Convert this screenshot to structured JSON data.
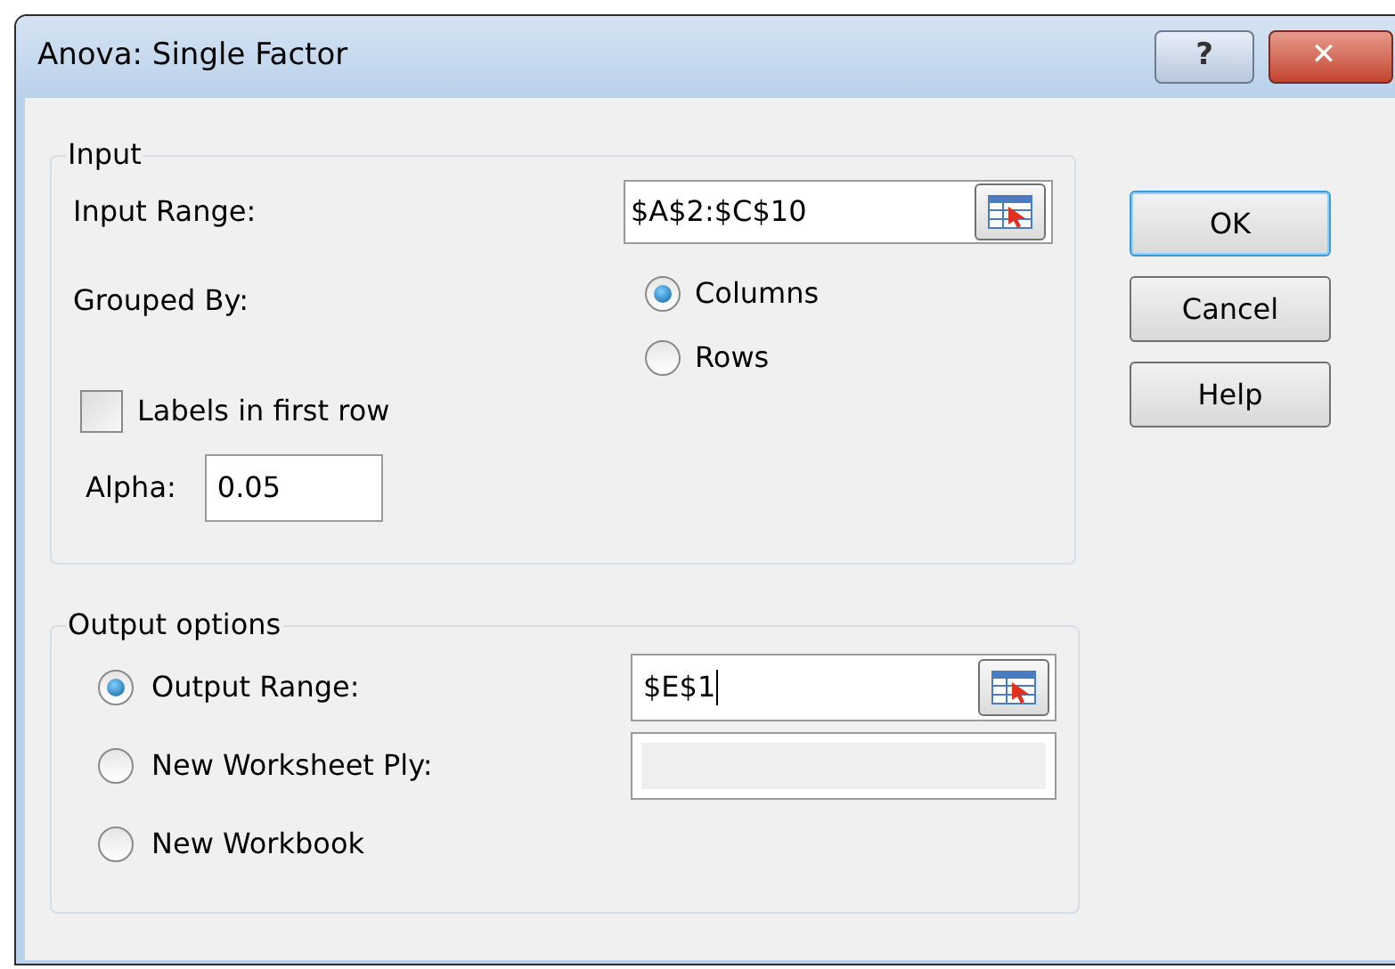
{
  "window": {
    "title": "Anova: Single Factor",
    "help_button": "?",
    "close_button": "✕"
  },
  "input": {
    "legend": "Input",
    "range_label": "Input Range:",
    "range_value": "$A$2:$C$10",
    "grouped_label": "Grouped By:",
    "grouped_options": [
      {
        "label": "Columns",
        "selected": true
      },
      {
        "label": "Rows",
        "selected": false
      }
    ],
    "labels_checkbox": {
      "label": "Labels in first row",
      "checked": false
    },
    "alpha_label": "Alpha:",
    "alpha_value": "0.05"
  },
  "output": {
    "legend": "Output options",
    "options": [
      {
        "label": "Output Range:",
        "selected": true,
        "kind": "range",
        "value": "$E$1",
        "disabled": false
      },
      {
        "label": "New Worksheet Ply:",
        "selected": false,
        "kind": "text",
        "disabled": true
      },
      {
        "label": "New Workbook",
        "selected": false,
        "kind": "plain"
      }
    ]
  },
  "buttons": [
    {
      "label": "OK",
      "default": true
    },
    {
      "label": "Cancel",
      "default": false
    },
    {
      "label": "Help",
      "default": false
    }
  ]
}
